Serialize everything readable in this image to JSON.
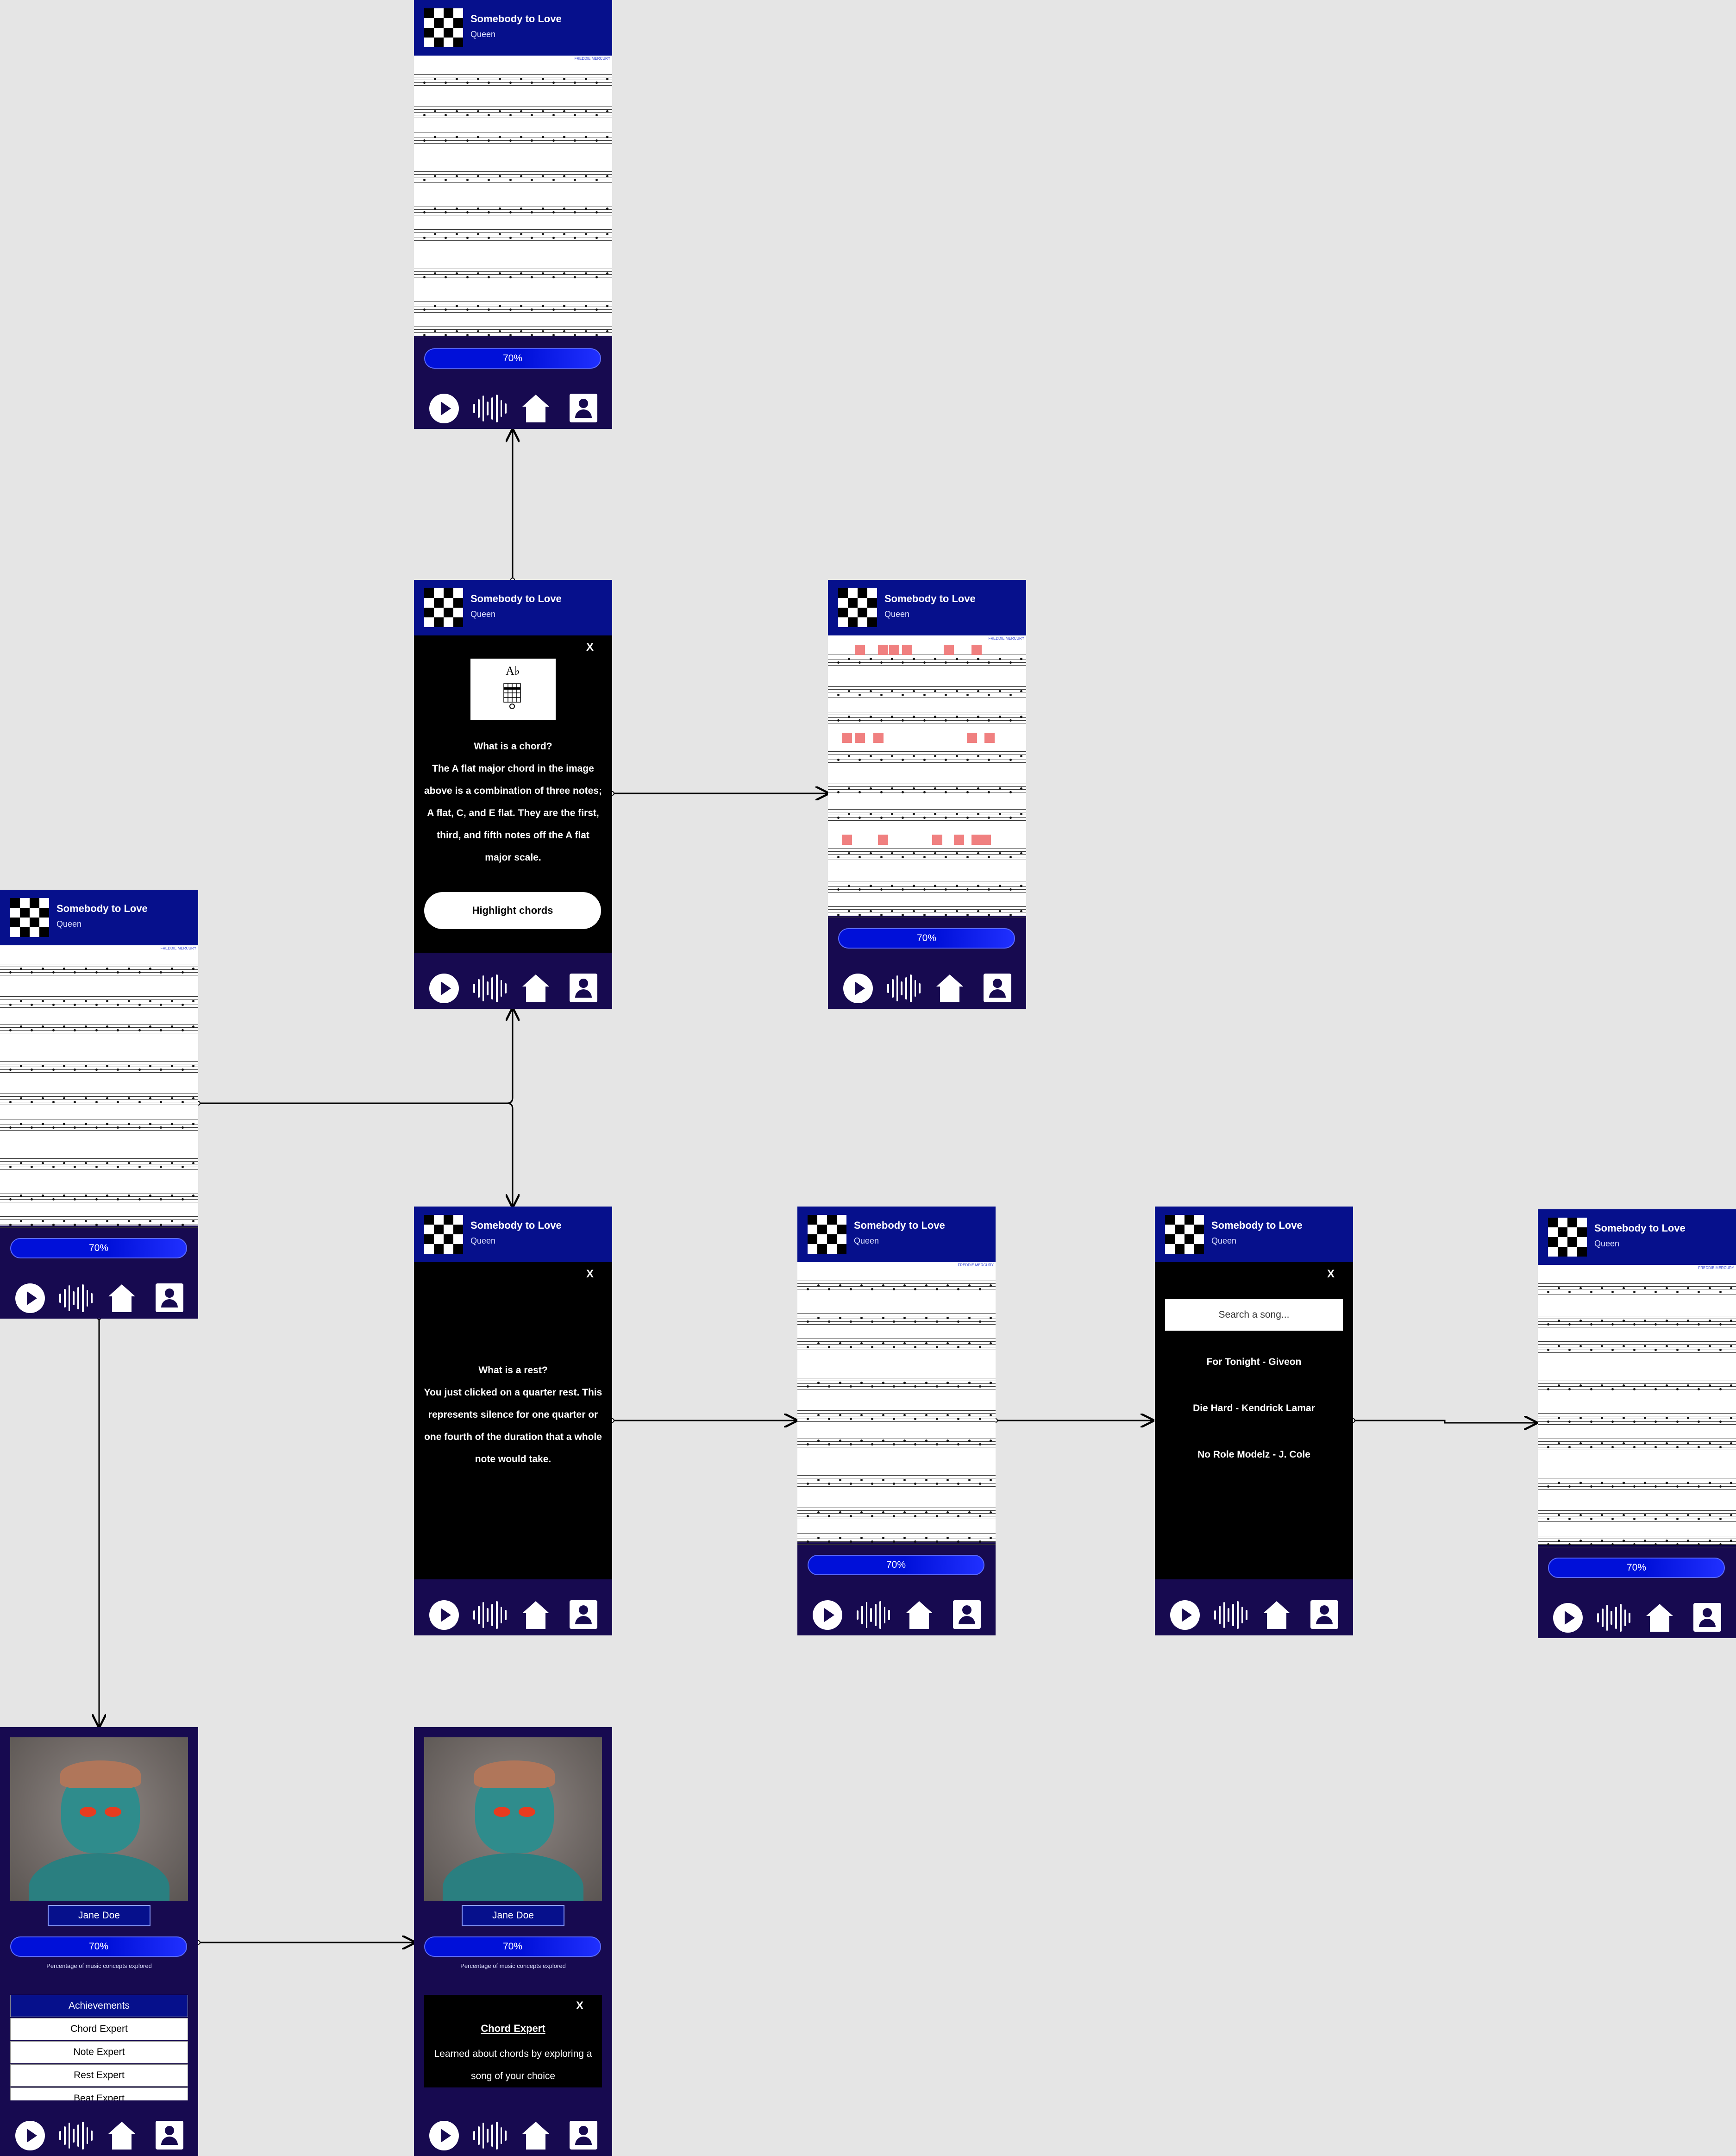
{
  "song": {
    "title": "Somebody to Love",
    "artist": "Queen"
  },
  "progress_label": "70%",
  "sheet_credit": "FREDDIE MERCURY",
  "chord_popup": {
    "close": "X",
    "heading": "What is a chord?",
    "body": "The A flat major chord in the image above is a combination of three notes; A flat, C, and E flat. They are the first, third, and fifth notes off the A flat major scale.",
    "button": "Highlight chords",
    "chord_symbol": "A♭"
  },
  "rest_popup": {
    "close": "X",
    "heading": "What is a rest?",
    "body": "You just clicked on a quarter rest. This represents silence for one quarter or one fourth of the duration that a whole note would take."
  },
  "search_popup": {
    "close": "X",
    "placeholder": "Search a song...",
    "songs": [
      "For Tonight - Giveon",
      "Die Hard - Kendrick Lamar",
      "No Role Modelz - J. Cole"
    ]
  },
  "profile": {
    "name": "Jane Doe",
    "progress_caption": "Percentage of music concepts explored",
    "achievements_header": "Achievements",
    "achievements": [
      "Chord Expert",
      "Note Expert",
      "Rest Expert",
      "Beat Expert"
    ]
  },
  "achievement_popup": {
    "close": "X",
    "title": "Chord Expert",
    "description": "Learned about chords by exploring a song of your choice"
  },
  "colors": {
    "header": "#06108c",
    "nav": "#170a50",
    "highlight": "#f08080",
    "canvas": "#e5e5e5"
  },
  "icons": [
    "checker-logo-icon",
    "play-icon",
    "waveform-icon",
    "home-icon",
    "user-icon"
  ]
}
